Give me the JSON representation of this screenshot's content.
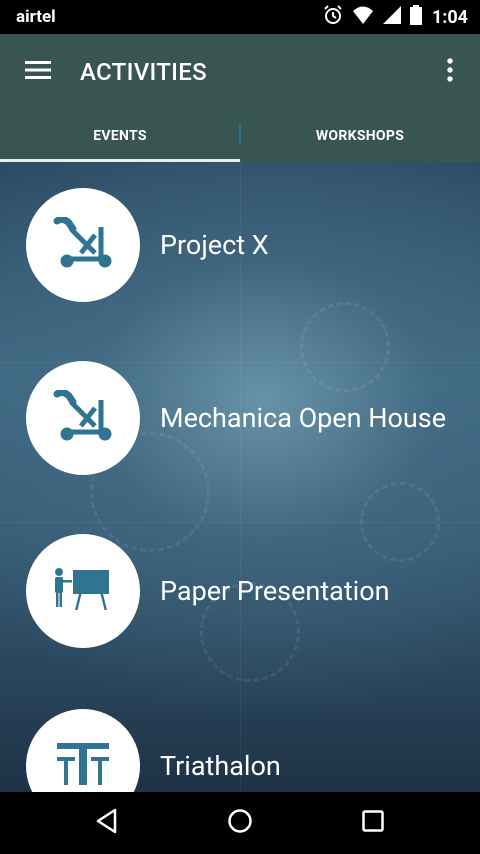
{
  "status_bar": {
    "carrier": "airtel",
    "time": "1:04"
  },
  "app_bar": {
    "title": "ACTIVITIES"
  },
  "tabs": [
    {
      "label": "EVENTS",
      "active": true
    },
    {
      "label": "WORKSHOPS",
      "active": false
    }
  ],
  "events": [
    {
      "label": "Project X",
      "icon": "catapult-icon"
    },
    {
      "label": "Mechanica Open House",
      "icon": "catapult-icon"
    },
    {
      "label": "Paper Presentation",
      "icon": "presentation-board-icon"
    },
    {
      "label": "Triathalon",
      "icon": "triathalon-icon"
    }
  ],
  "colors": {
    "app_bar": "#385552",
    "icon": "#2f7591",
    "tab_divider": "#1f74a4"
  }
}
